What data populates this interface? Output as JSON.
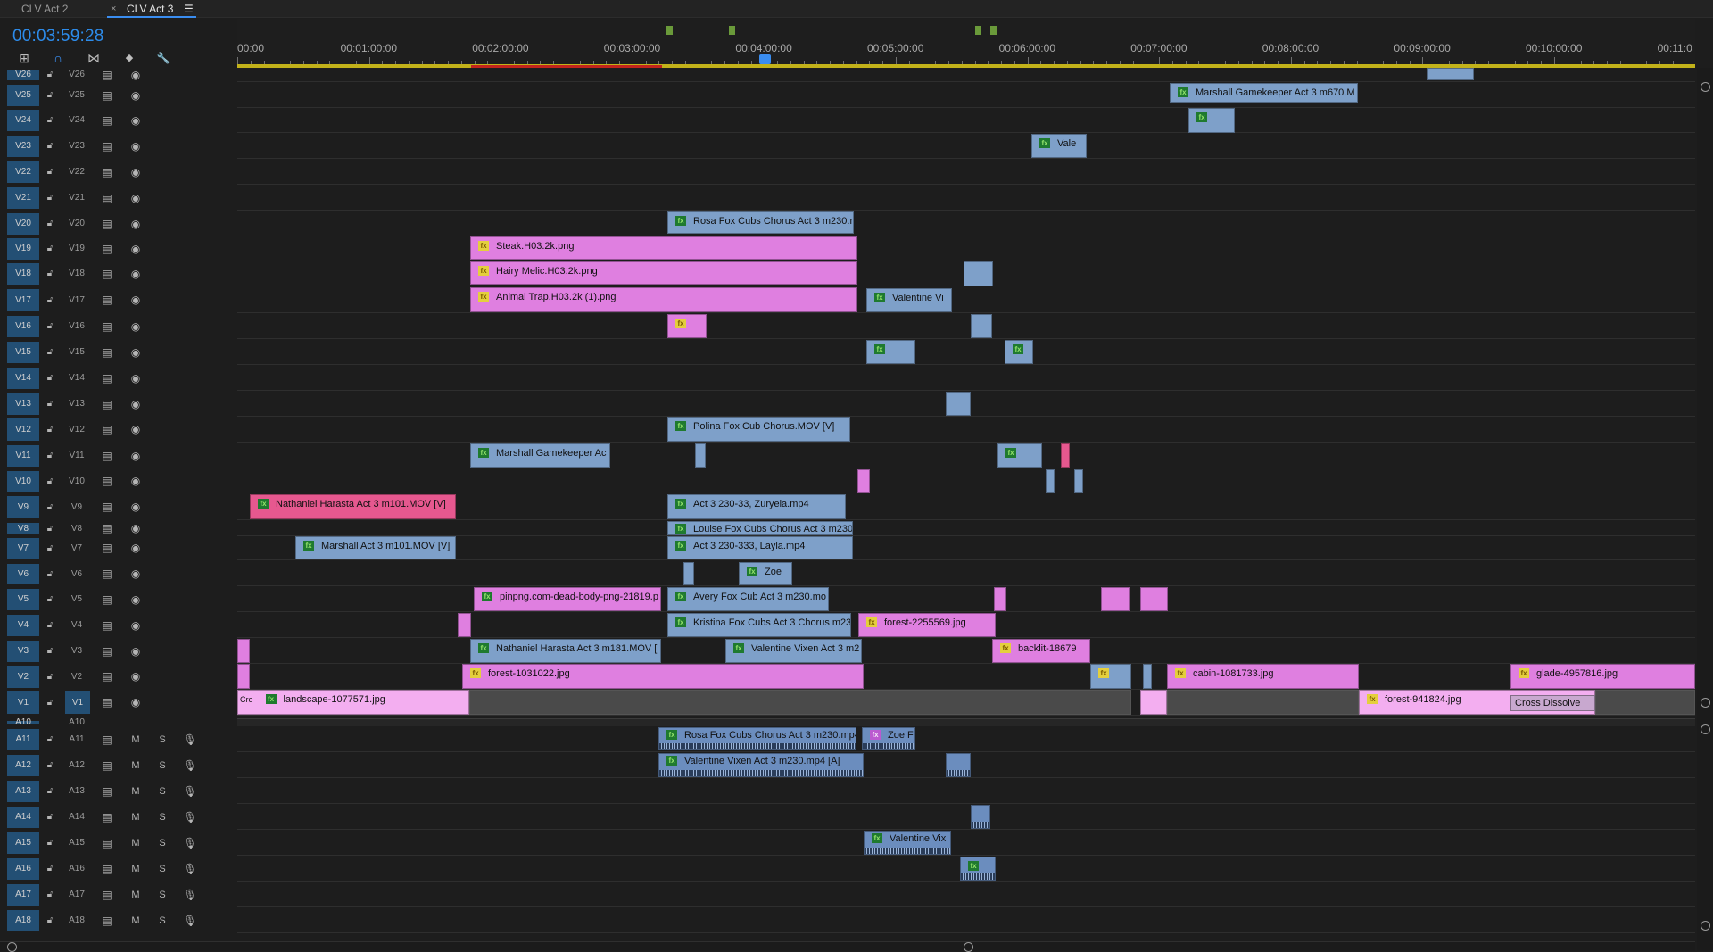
{
  "tabs": [
    {
      "label": "CLV Act 2",
      "active": false,
      "closable": false
    },
    {
      "label": "CLV Act 3",
      "active": true,
      "closable": true
    }
  ],
  "tab_close_glyph": "×",
  "tab_menu_glyph": "☰",
  "timecode": "00:03:59:28",
  "tools": [
    {
      "name": "insert-sequence-icon",
      "glyph": "⊞"
    },
    {
      "name": "snap-magnet-icon",
      "glyph": "∩"
    },
    {
      "name": "linked-selection-icon",
      "glyph": "⋈"
    },
    {
      "name": "add-marker-icon",
      "glyph": "◆"
    },
    {
      "name": "wrench-settings-icon",
      "glyph": "🔧"
    }
  ],
  "ruler_labels": [
    "00:00",
    "00:01:00:00",
    "00:02:00:00",
    "00:03:00:00",
    "00:04:00:00",
    "00:05:00:00",
    "00:06:00:00",
    "00:07:00:00",
    "00:08:00:00",
    "00:09:00:00",
    "00:10:00:00",
    "00:11:0"
  ],
  "video_tracks": [
    "V26",
    "V25",
    "V24",
    "V23",
    "V22",
    "V21",
    "V20",
    "V19",
    "V18",
    "V17",
    "V16",
    "V15",
    "V14",
    "V13",
    "V12",
    "V11",
    "V10",
    "V9",
    "V8",
    "V7",
    "V6",
    "V5",
    "V4",
    "V3",
    "V2",
    "V1"
  ],
  "audio_tracks": [
    "A10",
    "A11",
    "A12",
    "A13",
    "A14",
    "A15",
    "A16",
    "A17",
    "A18"
  ],
  "audio_ms": {
    "m": "M",
    "s": "S"
  },
  "clips": {
    "v25_marshall": "Marshall Gamekeeper Act 3 m670.M",
    "v23_vale": "Vale",
    "v20_rosa": "Rosa Fox Cubs Chorus Act 3 m230.m",
    "v19_steak": "Steak.H03.2k.png",
    "v18_hairy": "Hairy Melic.H03.2k.png",
    "v17_animal": "Animal Trap.H03.2k (1).png",
    "v17_valentine": "Valentine Vi",
    "v12_polina": "Polina Fox Cub Chorus.MOV [V]",
    "v11_marshall": "Marshall Gamekeeper Ac",
    "v9_nathaniel": "Nathaniel Harasta Act 3 m101.MOV [V]",
    "v9_act3": "Act 3 230-33, Zuryela.mp4",
    "v8_louise": "Louise Fox Cubs Chorus Act 3 m230.",
    "v7_marshall": "Marshall Act 3 m101.MOV [V]",
    "v7_act3": "Act 3 230-333, Layla.mp4",
    "v6_zoe": "Zoe",
    "v5_pinpng": "pinpng.com-dead-body-png-21819.p",
    "v5_avery": "Avery Fox Cub Act 3 m230.mo",
    "v4_kristina": "Kristina Fox Cubs Act 3 Chorus m23",
    "v4_forest": "forest-2255569.jpg",
    "v3_nathaniel": "Nathaniel Harasta Act 3 m181.MOV [",
    "v3_valentine": "Valentine Vixen Act 3 m2",
    "v3_backlit": "backlit-18679",
    "v2_forest": "forest-1031022.jpg",
    "v2_cabin": "cabin-1081733.jpg",
    "v2_glade": "glade-4957816.jpg",
    "v1_landscape": "landscape-1077571.jpg",
    "v1_forest": "forest-941824.jpg",
    "v1_cross": "Cross Dissolve",
    "v1_cre": "Cre",
    "a11_rosa": "Rosa Fox Cubs Chorus Act 3 m230.mp4",
    "a11_zoe": "Zoe F",
    "a12_valentine": "Valentine Vixen Act 3 m230.mp4 [A]",
    "a15_valentine": "Valentine Vix"
  },
  "colors": {
    "accent": "#2d8ceb",
    "video_clip": "#7ea0c9",
    "graphic_clip": "#df7fe0",
    "nested_clip": "#e6588f",
    "track_label": "#234f74",
    "work_area": "#c2b21a"
  }
}
